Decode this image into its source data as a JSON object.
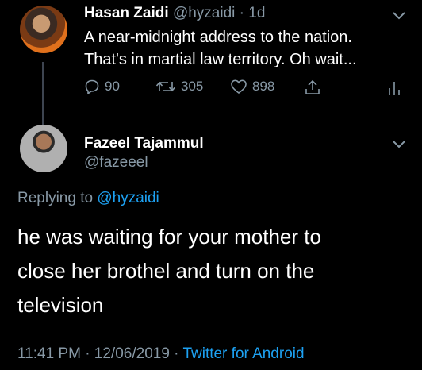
{
  "parent_tweet": {
    "display_name": "Hasan Zaidi",
    "handle": "@hyzaidi",
    "separator": "·",
    "time": "1d",
    "text_line1": "A near-midnight address to the nation.",
    "text_line2": "That's in martial law territory. Oh wait...",
    "actions": {
      "replies": "90",
      "retweets": "305",
      "likes": "898"
    },
    "icons": [
      "reply-icon",
      "retweet-icon",
      "like-icon",
      "share-icon",
      "analytics-icon",
      "chevron-down-icon"
    ]
  },
  "reply_tweet": {
    "display_name": "Fazeel Tajammul",
    "handle": "@fazeeel",
    "replying_prefix": "Replying to",
    "replying_to": "@hyzaidi",
    "text_line1": "he was waiting for your mother to",
    "text_line2": "close her brothel and turn on the",
    "text_line3": "television",
    "timestamp": "11:41 PM · 12/06/2019 ·",
    "client": "Twitter for Android"
  },
  "colors": {
    "background": "#000000",
    "muted": "#8899a6",
    "accent": "#1da1f2",
    "text": "#ffffff"
  }
}
